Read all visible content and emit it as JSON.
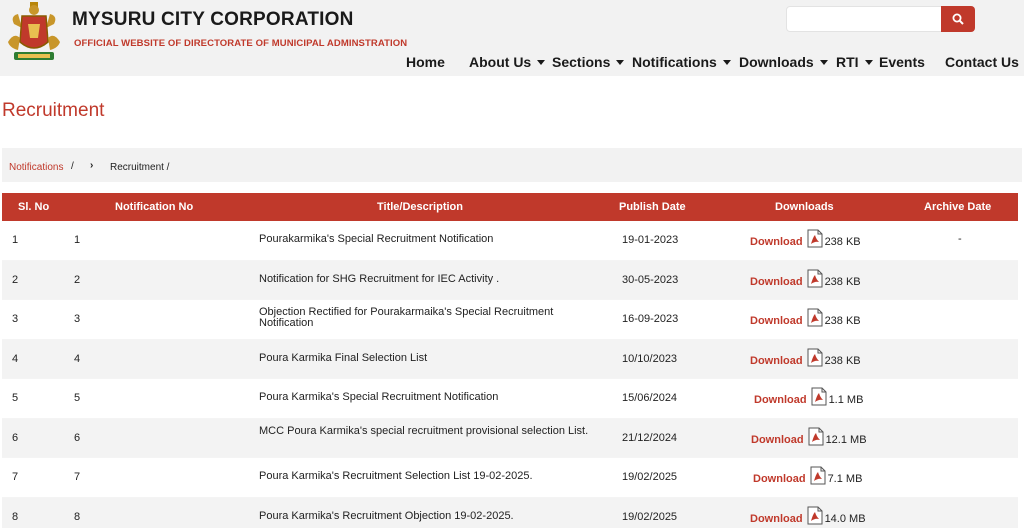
{
  "header": {
    "title": "MYSURU CITY CORPORATION",
    "subtitle": "OFFICIAL WEBSITE OF DIRECTORATE OF MUNICIPAL ADMINSTRATION",
    "search_placeholder": ""
  },
  "nav": {
    "items": [
      {
        "label": "Home",
        "dropdown": false
      },
      {
        "label": "About Us",
        "dropdown": true
      },
      {
        "label": "Sections",
        "dropdown": true
      },
      {
        "label": "Notifications",
        "dropdown": true
      },
      {
        "label": "Downloads",
        "dropdown": true
      },
      {
        "label": "RTI",
        "dropdown": true
      },
      {
        "label": "Events",
        "dropdown": false
      },
      {
        "label": "Contact Us",
        "dropdown": false
      }
    ]
  },
  "page": {
    "title": "Recruitment"
  },
  "breadcrumb": {
    "link": "Notifications",
    "sep": "/",
    "arrow": "›",
    "current": "Recruitment /"
  },
  "table": {
    "headers": [
      "Sl. No",
      "Notification No",
      "Title/Description",
      "Publish Date",
      "Downloads",
      "Archive Date"
    ],
    "download_label": "Download",
    "rows": [
      {
        "sl": "1",
        "no": "1",
        "title": "Pourakarmika's Special  Recruitment  Notification",
        "date": "19-01-2023",
        "size": "238 KB",
        "archive": "-"
      },
      {
        "sl": "2",
        "no": "2",
        "title": "Notification for SHG Recruitment for IEC Activity .",
        "date": "30-05-2023",
        "size": "238 KB",
        "archive": ""
      },
      {
        "sl": "3",
        "no": "3",
        "title": "Objection Rectified for Pourakarmaika's Special Recruitment Notification",
        "date": "16-09-2023",
        "size": "238 KB",
        "archive": ""
      },
      {
        "sl": "4",
        "no": "4",
        "title": "Poura Karmika Final Selection List",
        "date": "10/10/2023",
        "size": "238 KB",
        "archive": ""
      },
      {
        "sl": "5",
        "no": "5",
        "title": "Poura Karmika's Special Recruitment Notification",
        "date": "15/06/2024",
        "size": "1.1 MB",
        "archive": ""
      },
      {
        "sl": "6",
        "no": "6",
        "title": "MCC Poura Karmika's special recruitment provisional selection List.",
        "date": "21/12/2024",
        "size": "12.1 MB",
        "archive": ""
      },
      {
        "sl": "7",
        "no": "7",
        "title": "Poura Karmika's Recruitment Selection List 19-02-2025.",
        "date": "19/02/2025",
        "size": "7.1 MB",
        "archive": ""
      },
      {
        "sl": "8",
        "no": "8",
        "title": "Poura Karmika's Recruitment Objection 19-02-2025.",
        "date": "19/02/2025",
        "size": "14.0 MB",
        "archive": ""
      }
    ]
  },
  "colors": {
    "accent": "#c0392b",
    "header_bg": "#f2f2f2"
  }
}
